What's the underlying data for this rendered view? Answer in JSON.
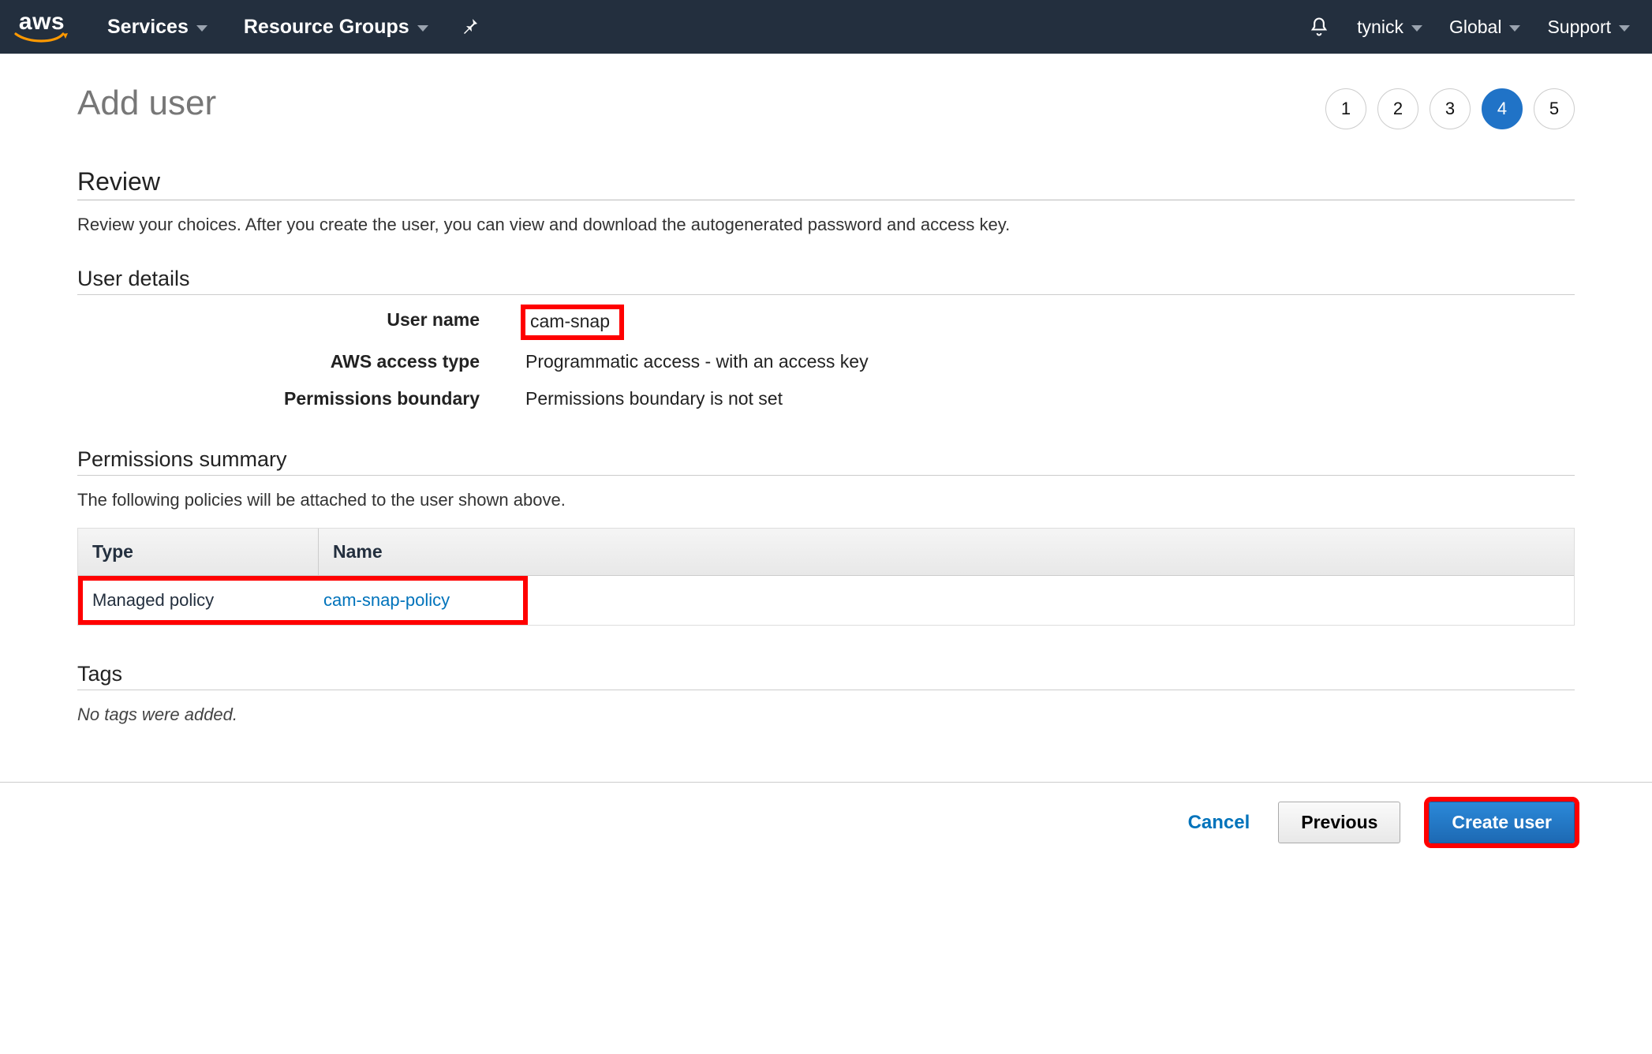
{
  "nav": {
    "services": "Services",
    "resource_groups": "Resource Groups",
    "username": "tynick",
    "region": "Global",
    "support": "Support"
  },
  "header": {
    "title": "Add user",
    "steps": [
      "1",
      "2",
      "3",
      "4",
      "5"
    ],
    "active_step": 4
  },
  "review": {
    "heading": "Review",
    "help": "Review your choices. After you create the user, you can view and download the autogenerated password and access key."
  },
  "user_details": {
    "heading": "User details",
    "rows": {
      "user_name_label": "User name",
      "user_name_value": "cam-snap",
      "access_type_label": "AWS access type",
      "access_type_value": "Programmatic access - with an access key",
      "perm_boundary_label": "Permissions boundary",
      "perm_boundary_value": "Permissions boundary is not set"
    }
  },
  "permissions": {
    "heading": "Permissions summary",
    "help": "The following policies will be attached to the user shown above.",
    "columns": {
      "type": "Type",
      "name": "Name"
    },
    "rows": [
      {
        "type": "Managed policy",
        "name": "cam-snap-policy"
      }
    ]
  },
  "tags": {
    "heading": "Tags",
    "message": "No tags were added."
  },
  "footer": {
    "cancel": "Cancel",
    "previous": "Previous",
    "create_user": "Create user"
  }
}
